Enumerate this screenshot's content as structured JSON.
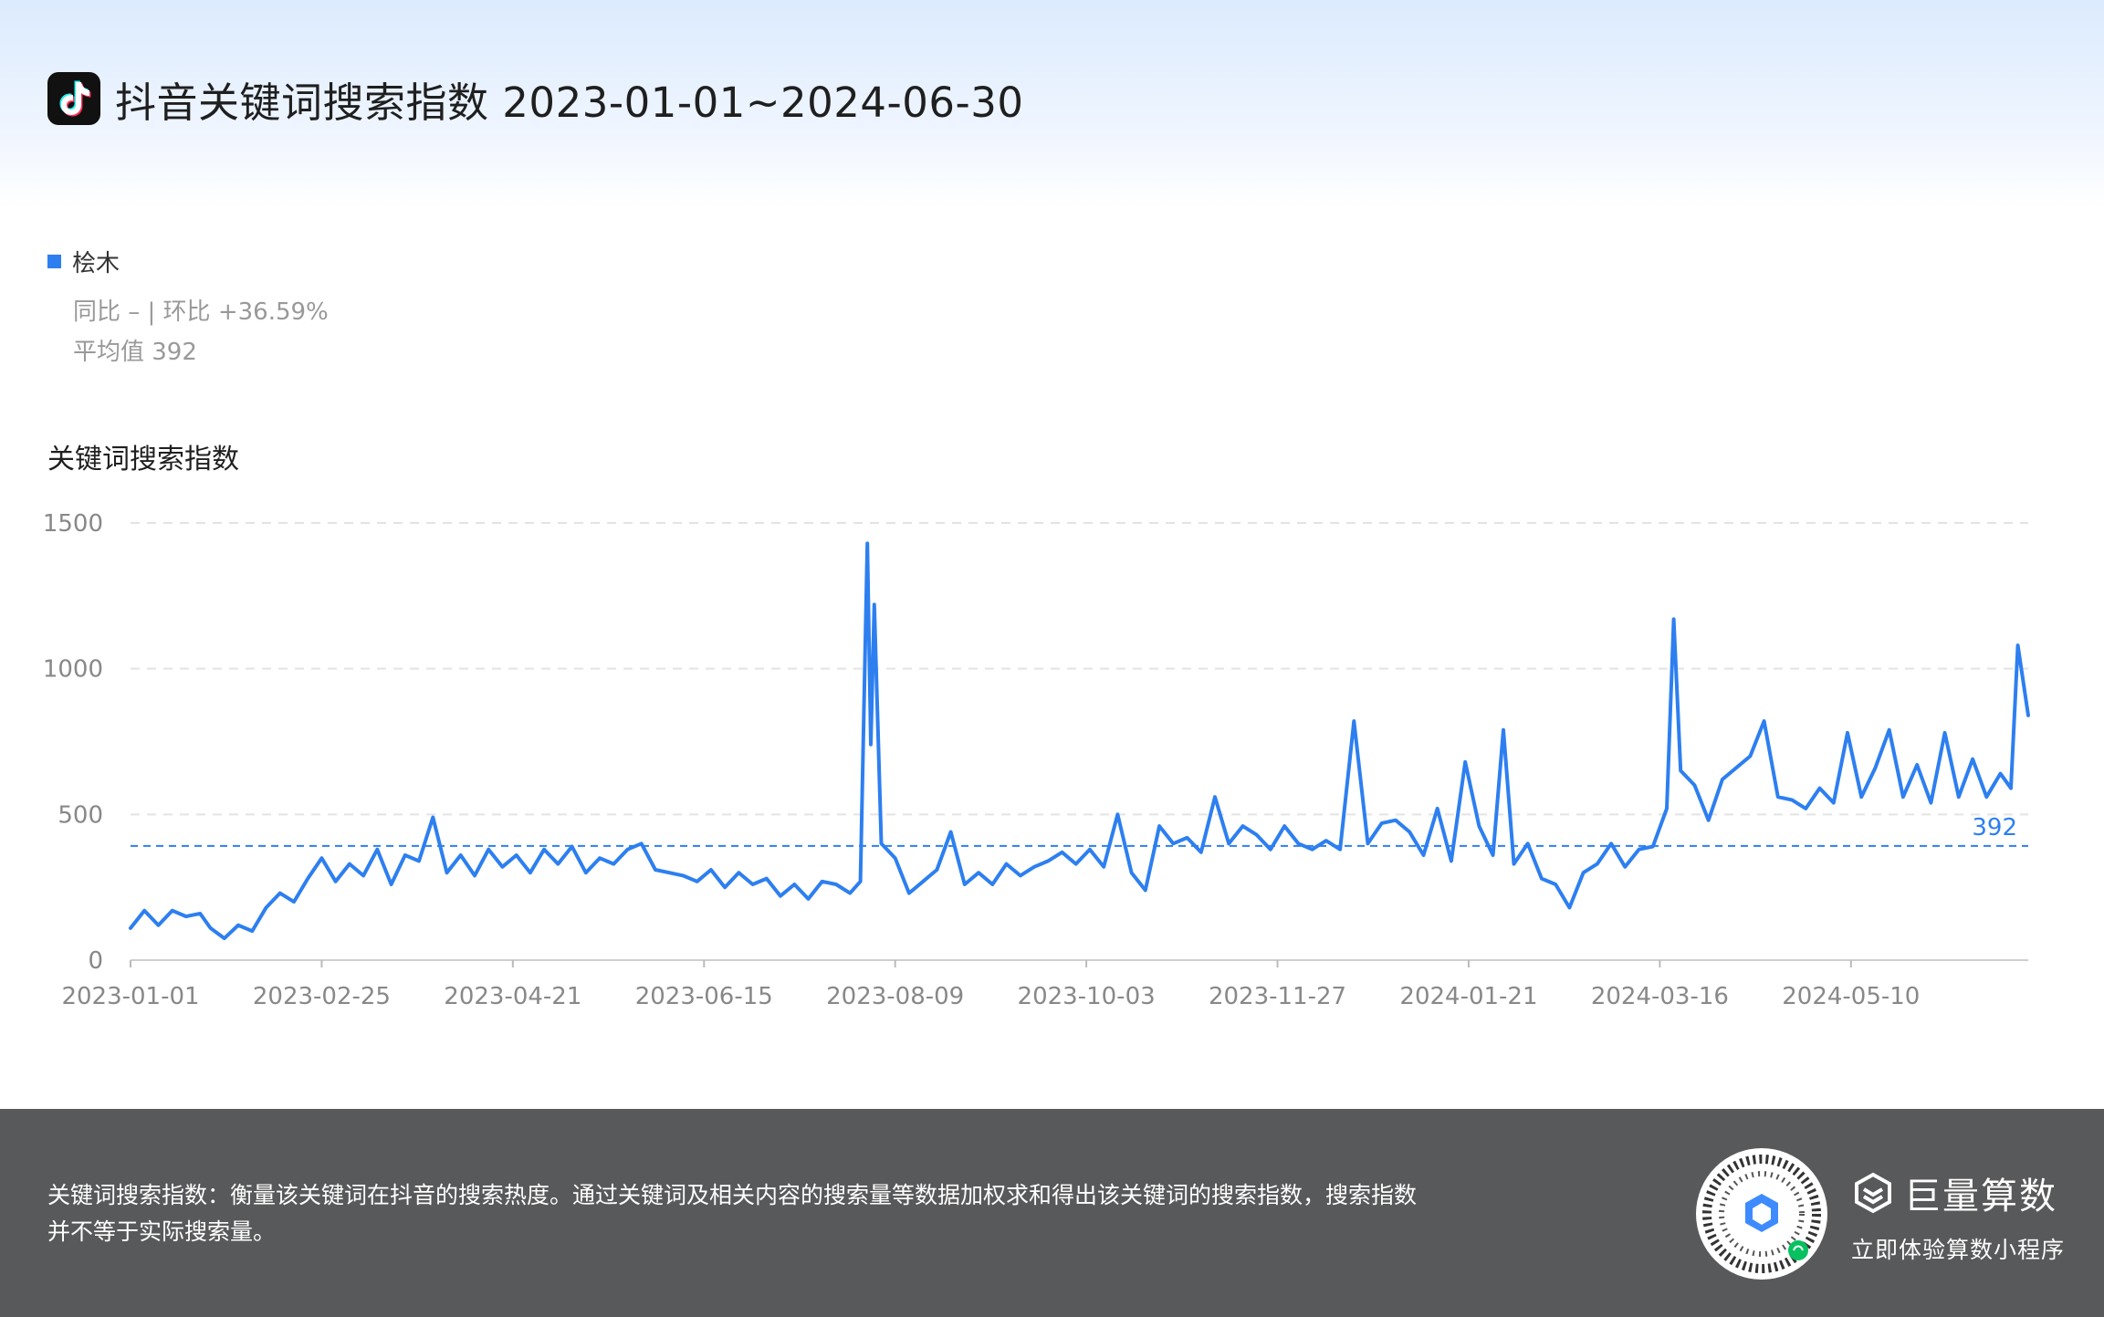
{
  "header": {
    "title": "抖音关键词搜索指数 2023-01-01~2024-06-30"
  },
  "legend": {
    "series_name": "桧木",
    "color": "#2d7ff0"
  },
  "stats": {
    "compare": "同比 – | 环比 +36.59%",
    "average": "平均值 392"
  },
  "chart_heading": "关键词搜索指数",
  "footer": {
    "note_line1": "关键词搜索指数：衡量该关键词在抖音的搜索热度。通过关键词及相关内容的搜索量等数据加权求和得出该关键词的搜索指数，搜索指数",
    "note_line2": "并不等于实际搜索量。",
    "brand": "巨量算数",
    "brand_sub": "立即体验算数小程序"
  },
  "chart_data": {
    "type": "line",
    "title": "关键词搜索指数",
    "xlabel": "",
    "ylabel": "",
    "ylim": [
      0,
      1500
    ],
    "yticks": [
      0,
      500,
      1000,
      1500
    ],
    "xticks": [
      "2023-01-01",
      "2023-02-25",
      "2023-04-21",
      "2023-06-15",
      "2023-08-09",
      "2023-10-03",
      "2023-11-27",
      "2024-01-21",
      "2024-03-16",
      "2024-05-10"
    ],
    "x_range": [
      "2023-01-01",
      "2024-06-30"
    ],
    "grid": true,
    "average": 392,
    "average_label": "392",
    "series": [
      {
        "name": "桧木",
        "color": "#2d7ff0",
        "points": [
          [
            "2023-01-01",
            110
          ],
          [
            "2023-01-05",
            170
          ],
          [
            "2023-01-09",
            120
          ],
          [
            "2023-01-13",
            170
          ],
          [
            "2023-01-17",
            150
          ],
          [
            "2023-01-21",
            160
          ],
          [
            "2023-01-24",
            110
          ],
          [
            "2023-01-28",
            75
          ],
          [
            "2023-02-01",
            120
          ],
          [
            "2023-02-05",
            100
          ],
          [
            "2023-02-09",
            180
          ],
          [
            "2023-02-13",
            230
          ],
          [
            "2023-02-17",
            200
          ],
          [
            "2023-02-21",
            280
          ],
          [
            "2023-02-25",
            350
          ],
          [
            "2023-03-01",
            270
          ],
          [
            "2023-03-05",
            330
          ],
          [
            "2023-03-09",
            290
          ],
          [
            "2023-03-13",
            380
          ],
          [
            "2023-03-17",
            260
          ],
          [
            "2023-03-21",
            360
          ],
          [
            "2023-03-25",
            340
          ],
          [
            "2023-03-29",
            490
          ],
          [
            "2023-04-02",
            300
          ],
          [
            "2023-04-06",
            360
          ],
          [
            "2023-04-10",
            290
          ],
          [
            "2023-04-14",
            380
          ],
          [
            "2023-04-18",
            320
          ],
          [
            "2023-04-22",
            360
          ],
          [
            "2023-04-26",
            300
          ],
          [
            "2023-04-30",
            380
          ],
          [
            "2023-05-04",
            330
          ],
          [
            "2023-05-08",
            390
          ],
          [
            "2023-05-12",
            300
          ],
          [
            "2023-05-16",
            350
          ],
          [
            "2023-05-20",
            330
          ],
          [
            "2023-05-24",
            380
          ],
          [
            "2023-05-28",
            400
          ],
          [
            "2023-06-01",
            310
          ],
          [
            "2023-06-05",
            300
          ],
          [
            "2023-06-09",
            290
          ],
          [
            "2023-06-13",
            270
          ],
          [
            "2023-06-17",
            310
          ],
          [
            "2023-06-21",
            250
          ],
          [
            "2023-06-25",
            300
          ],
          [
            "2023-06-29",
            260
          ],
          [
            "2023-07-03",
            280
          ],
          [
            "2023-07-07",
            220
          ],
          [
            "2023-07-11",
            260
          ],
          [
            "2023-07-15",
            210
          ],
          [
            "2023-07-19",
            270
          ],
          [
            "2023-07-23",
            260
          ],
          [
            "2023-07-27",
            230
          ],
          [
            "2023-07-30",
            270
          ],
          [
            "2023-08-01",
            1430
          ],
          [
            "2023-08-02",
            740
          ],
          [
            "2023-08-03",
            1220
          ],
          [
            "2023-08-05",
            400
          ],
          [
            "2023-08-09",
            350
          ],
          [
            "2023-08-13",
            230
          ],
          [
            "2023-08-17",
            270
          ],
          [
            "2023-08-21",
            310
          ],
          [
            "2023-08-25",
            440
          ],
          [
            "2023-08-29",
            260
          ],
          [
            "2023-09-02",
            300
          ],
          [
            "2023-09-06",
            260
          ],
          [
            "2023-09-10",
            330
          ],
          [
            "2023-09-14",
            290
          ],
          [
            "2023-09-18",
            320
          ],
          [
            "2023-09-22",
            340
          ],
          [
            "2023-09-26",
            370
          ],
          [
            "2023-09-30",
            330
          ],
          [
            "2023-10-04",
            380
          ],
          [
            "2023-10-08",
            320
          ],
          [
            "2023-10-12",
            500
          ],
          [
            "2023-10-16",
            300
          ],
          [
            "2023-10-20",
            240
          ],
          [
            "2023-10-24",
            460
          ],
          [
            "2023-10-28",
            400
          ],
          [
            "2023-11-01",
            420
          ],
          [
            "2023-11-05",
            370
          ],
          [
            "2023-11-09",
            560
          ],
          [
            "2023-11-13",
            400
          ],
          [
            "2023-11-17",
            460
          ],
          [
            "2023-11-21",
            430
          ],
          [
            "2023-11-25",
            380
          ],
          [
            "2023-11-29",
            460
          ],
          [
            "2023-12-03",
            400
          ],
          [
            "2023-12-07",
            380
          ],
          [
            "2023-12-11",
            410
          ],
          [
            "2023-12-15",
            380
          ],
          [
            "2023-12-19",
            820
          ],
          [
            "2023-12-23",
            400
          ],
          [
            "2023-12-27",
            470
          ],
          [
            "2023-12-31",
            480
          ],
          [
            "2024-01-04",
            440
          ],
          [
            "2024-01-08",
            360
          ],
          [
            "2024-01-12",
            520
          ],
          [
            "2024-01-16",
            340
          ],
          [
            "2024-01-20",
            680
          ],
          [
            "2024-01-24",
            460
          ],
          [
            "2024-01-28",
            360
          ],
          [
            "2024-01-31",
            790
          ],
          [
            "2024-02-03",
            330
          ],
          [
            "2024-02-07",
            400
          ],
          [
            "2024-02-11",
            280
          ],
          [
            "2024-02-15",
            260
          ],
          [
            "2024-02-19",
            180
          ],
          [
            "2024-02-23",
            300
          ],
          [
            "2024-02-27",
            330
          ],
          [
            "2024-03-02",
            400
          ],
          [
            "2024-03-06",
            320
          ],
          [
            "2024-03-10",
            380
          ],
          [
            "2024-03-14",
            390
          ],
          [
            "2024-03-18",
            520
          ],
          [
            "2024-03-20",
            1170
          ],
          [
            "2024-03-22",
            650
          ],
          [
            "2024-03-26",
            600
          ],
          [
            "2024-03-30",
            480
          ],
          [
            "2024-04-03",
            620
          ],
          [
            "2024-04-07",
            660
          ],
          [
            "2024-04-11",
            700
          ],
          [
            "2024-04-15",
            820
          ],
          [
            "2024-04-19",
            560
          ],
          [
            "2024-04-23",
            550
          ],
          [
            "2024-04-27",
            520
          ],
          [
            "2024-05-01",
            590
          ],
          [
            "2024-05-05",
            540
          ],
          [
            "2024-05-09",
            780
          ],
          [
            "2024-05-13",
            560
          ],
          [
            "2024-05-17",
            660
          ],
          [
            "2024-05-21",
            790
          ],
          [
            "2024-05-25",
            560
          ],
          [
            "2024-05-29",
            670
          ],
          [
            "2024-06-02",
            540
          ],
          [
            "2024-06-06",
            780
          ],
          [
            "2024-06-10",
            560
          ],
          [
            "2024-06-14",
            690
          ],
          [
            "2024-06-18",
            560
          ],
          [
            "2024-06-22",
            640
          ],
          [
            "2024-06-25",
            590
          ],
          [
            "2024-06-27",
            1080
          ],
          [
            "2024-06-30",
            840
          ]
        ]
      }
    ]
  }
}
